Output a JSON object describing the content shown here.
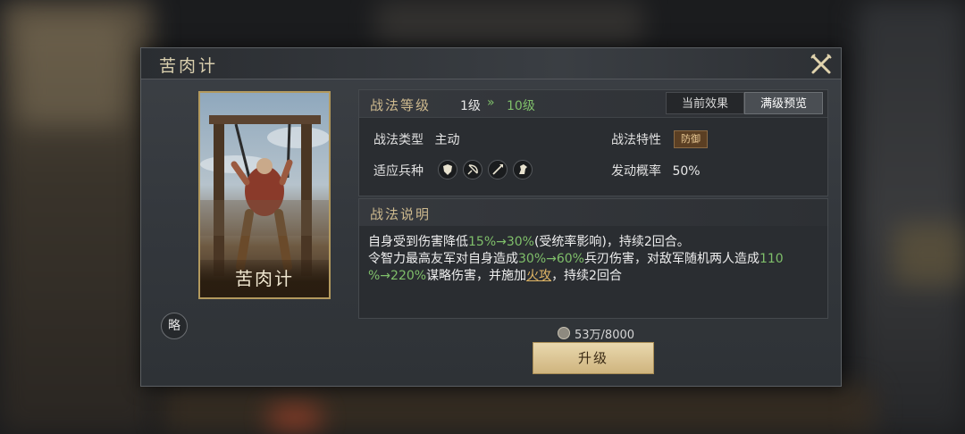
{
  "dialog": {
    "title": "苦肉计"
  },
  "card": {
    "name": "苦肉计"
  },
  "side_button": {
    "label": "略"
  },
  "level": {
    "label": "战法等级",
    "current": "1级",
    "arrow": "»",
    "max": "10级"
  },
  "tabs": [
    {
      "label": "当前效果",
      "selected": false
    },
    {
      "label": "满级预览",
      "selected": true
    }
  ],
  "attributes": {
    "type_label": "战法类型",
    "type_value": "主动",
    "trait_label": "战法特性",
    "trait_value": "防御",
    "troops_label": "适应兵种",
    "troops_icons": [
      "shield-icon",
      "bow-icon",
      "spear-icon",
      "horse-icon"
    ],
    "rate_label": "发动概率",
    "rate_value": "50%"
  },
  "description": {
    "title": "战法说明",
    "l1_a": "自身受到伤害降低",
    "l1_g": "15%→30%",
    "l1_b": "(受统率影响)，持续2回合。",
    "l2_a": "令智力最高友军对自身造成",
    "l2_g": "30%→60%",
    "l2_b": "兵刃伤害，对敌军随机两人造成",
    "l2_g2": "110",
    "l3_g": "%→220%",
    "l3_a": "谋略伤害，并施加",
    "l3_y": "火攻",
    "l3_b": "，持续2回合"
  },
  "cost": {
    "value": "53万/8000"
  },
  "upgrade_button": {
    "label": "升级"
  },
  "colors": {
    "highlight_green": "#7fbf6a",
    "highlight_gold": "#e2b766",
    "button_gold": "#e9d8ae"
  }
}
